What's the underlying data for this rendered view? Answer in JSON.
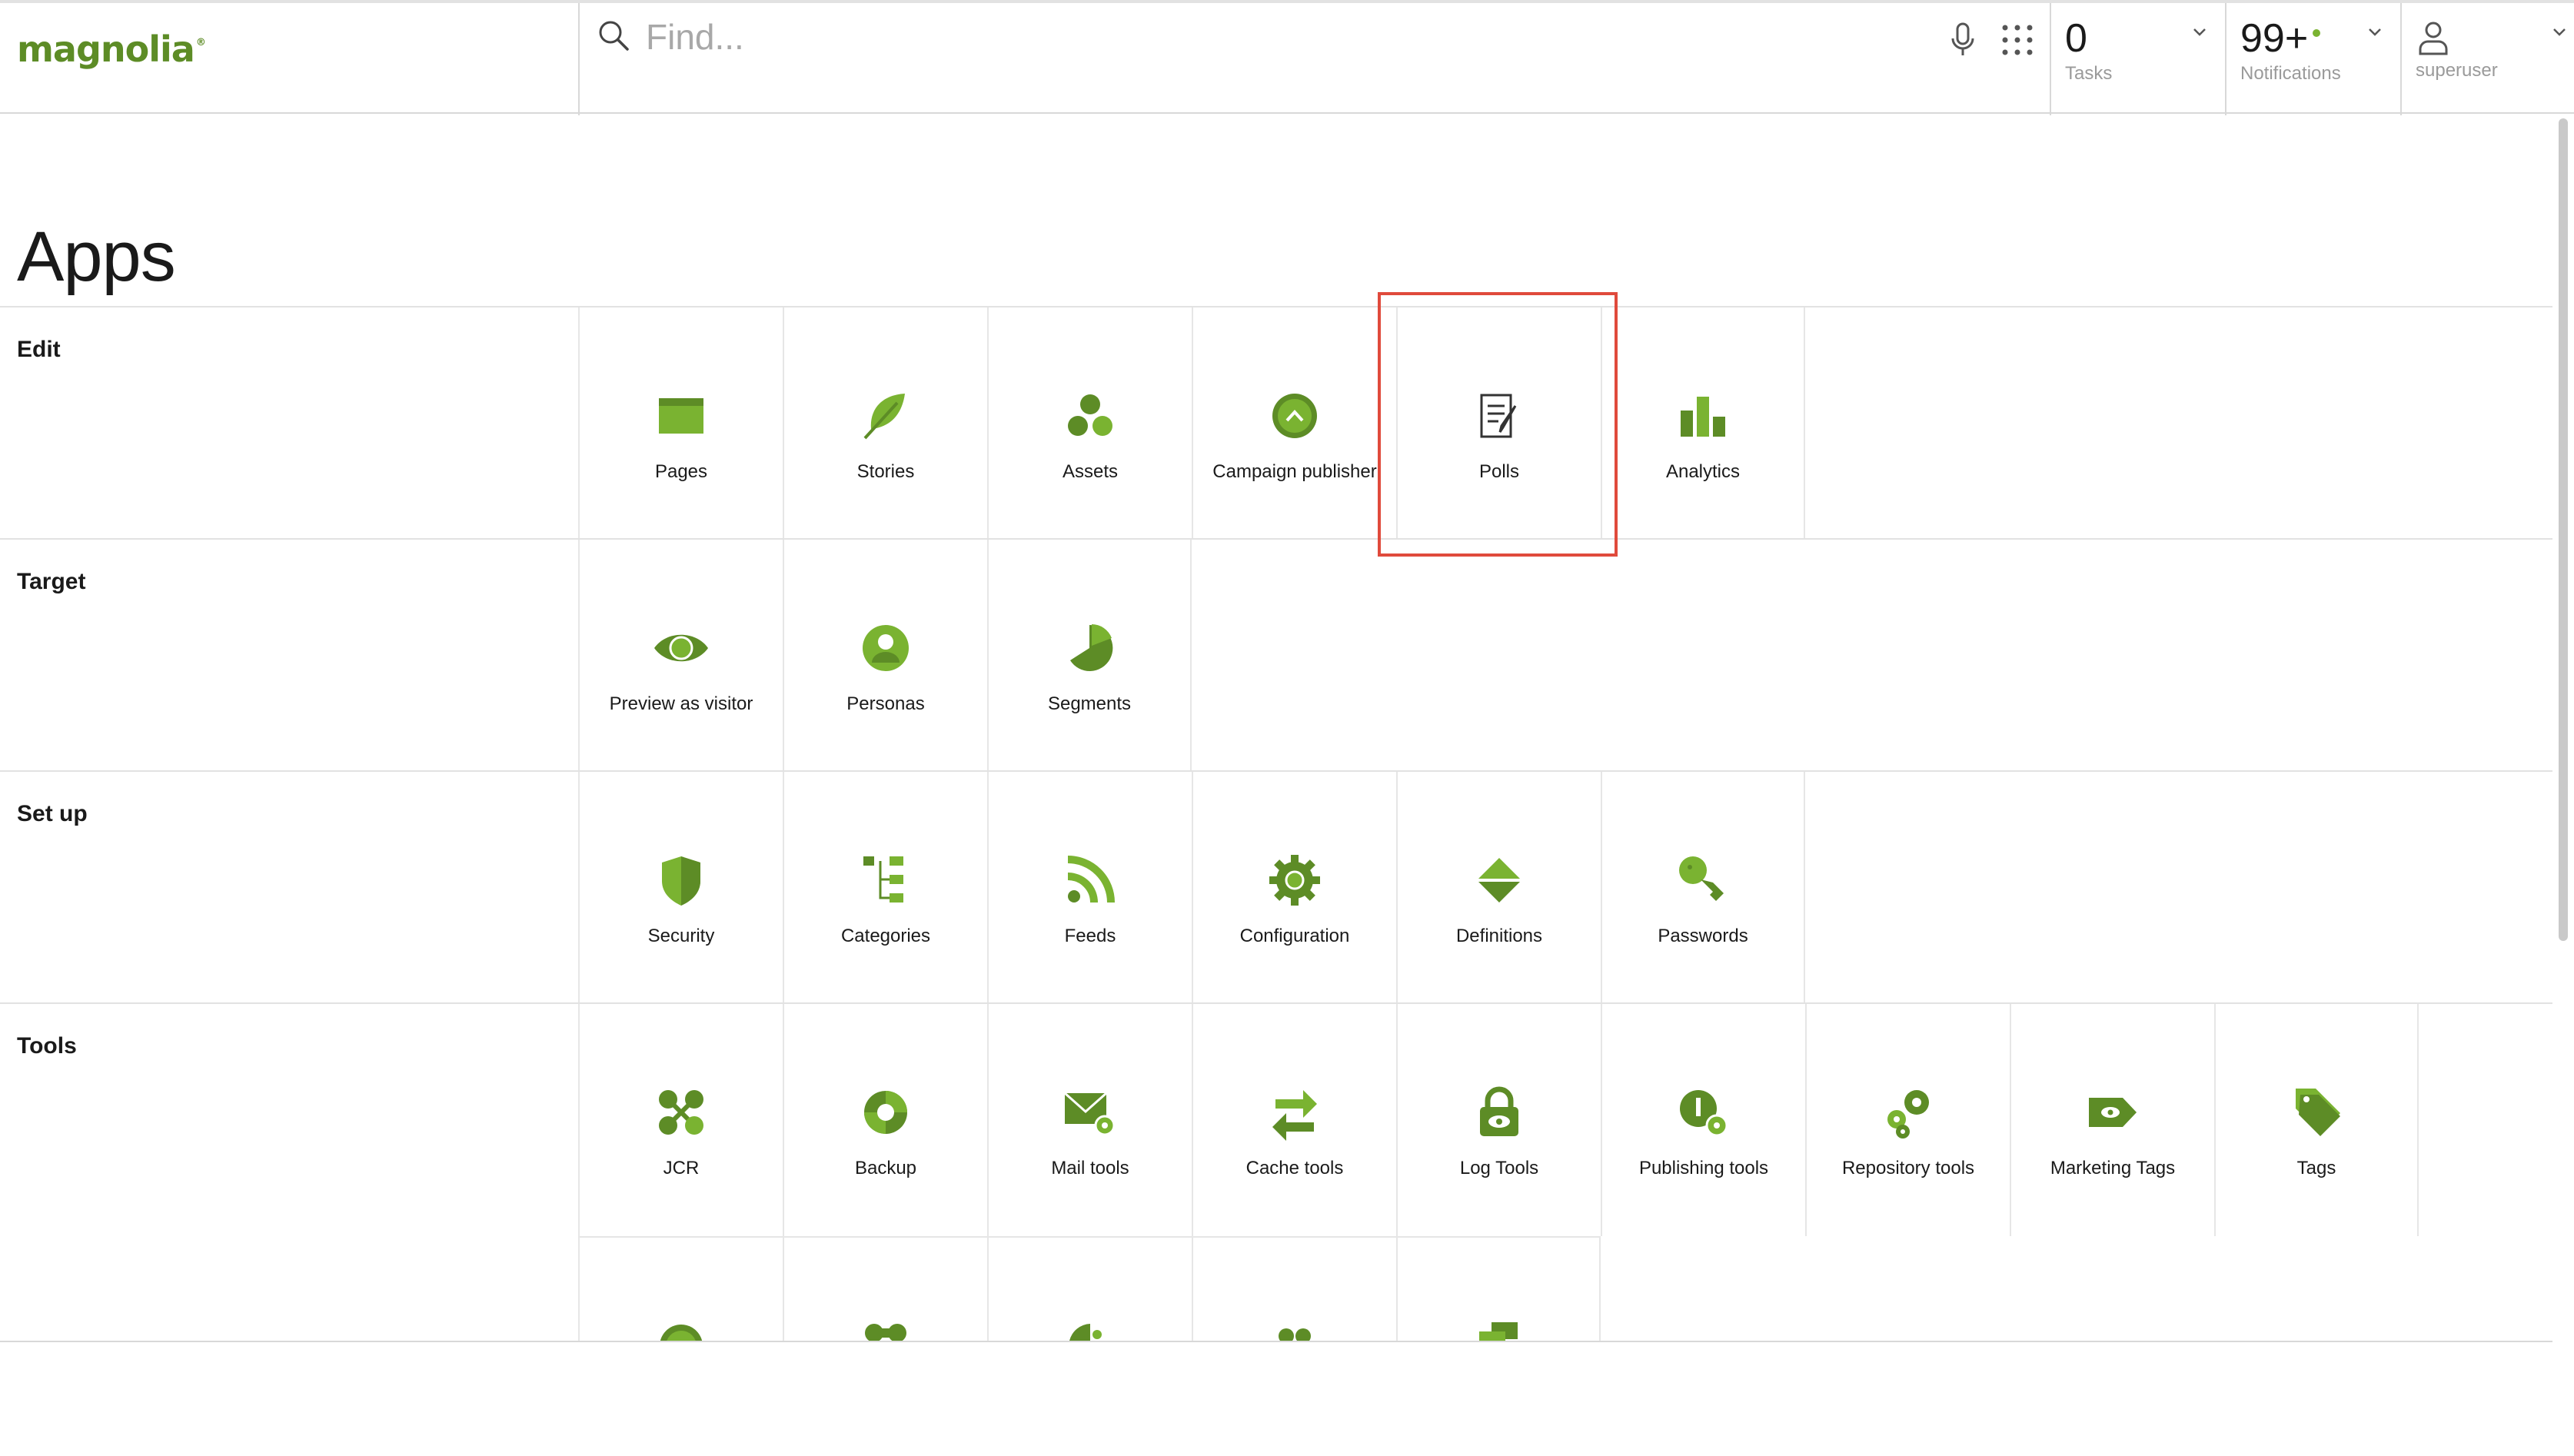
{
  "brand": {
    "logo_text": "magnolia",
    "accent": "#7ab331",
    "accent_dark": "#5d8c26",
    "selection_color": "#e04a3c"
  },
  "header": {
    "search_placeholder": "Find...",
    "tasks": {
      "count": "0",
      "label": "Tasks"
    },
    "notifications": {
      "count": "99+",
      "label": "Notifications"
    },
    "user": {
      "label": "superuser"
    }
  },
  "page": {
    "title": "Apps"
  },
  "groups": [
    {
      "name": "Edit",
      "apps": [
        {
          "label": "Pages",
          "icon": "pages-icon"
        },
        {
          "label": "Stories",
          "icon": "stories-feather-icon"
        },
        {
          "label": "Assets",
          "icon": "assets-icon"
        },
        {
          "label": "Campaign publisher",
          "icon": "campaign-publisher-icon"
        },
        {
          "label": "Polls",
          "icon": "polls-icon",
          "selected": true
        },
        {
          "label": "Analytics",
          "icon": "analytics-icon"
        }
      ]
    },
    {
      "name": "Target",
      "apps": [
        {
          "label": "Preview as visitor",
          "icon": "eye-icon"
        },
        {
          "label": "Personas",
          "icon": "persona-icon"
        },
        {
          "label": "Segments",
          "icon": "pie-segment-icon"
        }
      ]
    },
    {
      "name": "Set up",
      "apps": [
        {
          "label": "Security",
          "icon": "shield-icon"
        },
        {
          "label": "Categories",
          "icon": "categories-tree-icon"
        },
        {
          "label": "Feeds",
          "icon": "rss-feed-icon"
        },
        {
          "label": "Configuration",
          "icon": "gear-icon"
        },
        {
          "label": "Definitions",
          "icon": "definitions-diamond-icon"
        },
        {
          "label": "Passwords",
          "icon": "key-icon"
        }
      ]
    },
    {
      "name": "Tools",
      "apps": [
        {
          "label": "JCR",
          "icon": "jcr-nodes-icon"
        },
        {
          "label": "Backup",
          "icon": "backup-icon"
        },
        {
          "label": "Mail tools",
          "icon": "mail-gear-icon"
        },
        {
          "label": "Cache tools",
          "icon": "cache-arrows-icon"
        },
        {
          "label": "Log Tools",
          "icon": "lock-eye-icon"
        },
        {
          "label": "Publishing tools",
          "icon": "publishing-gear-icon"
        },
        {
          "label": "Repository tools",
          "icon": "gears-icon"
        },
        {
          "label": "Marketing Tags",
          "icon": "marketing-tag-icon"
        },
        {
          "label": "Tags",
          "icon": "tags-icon"
        }
      ]
    }
  ]
}
